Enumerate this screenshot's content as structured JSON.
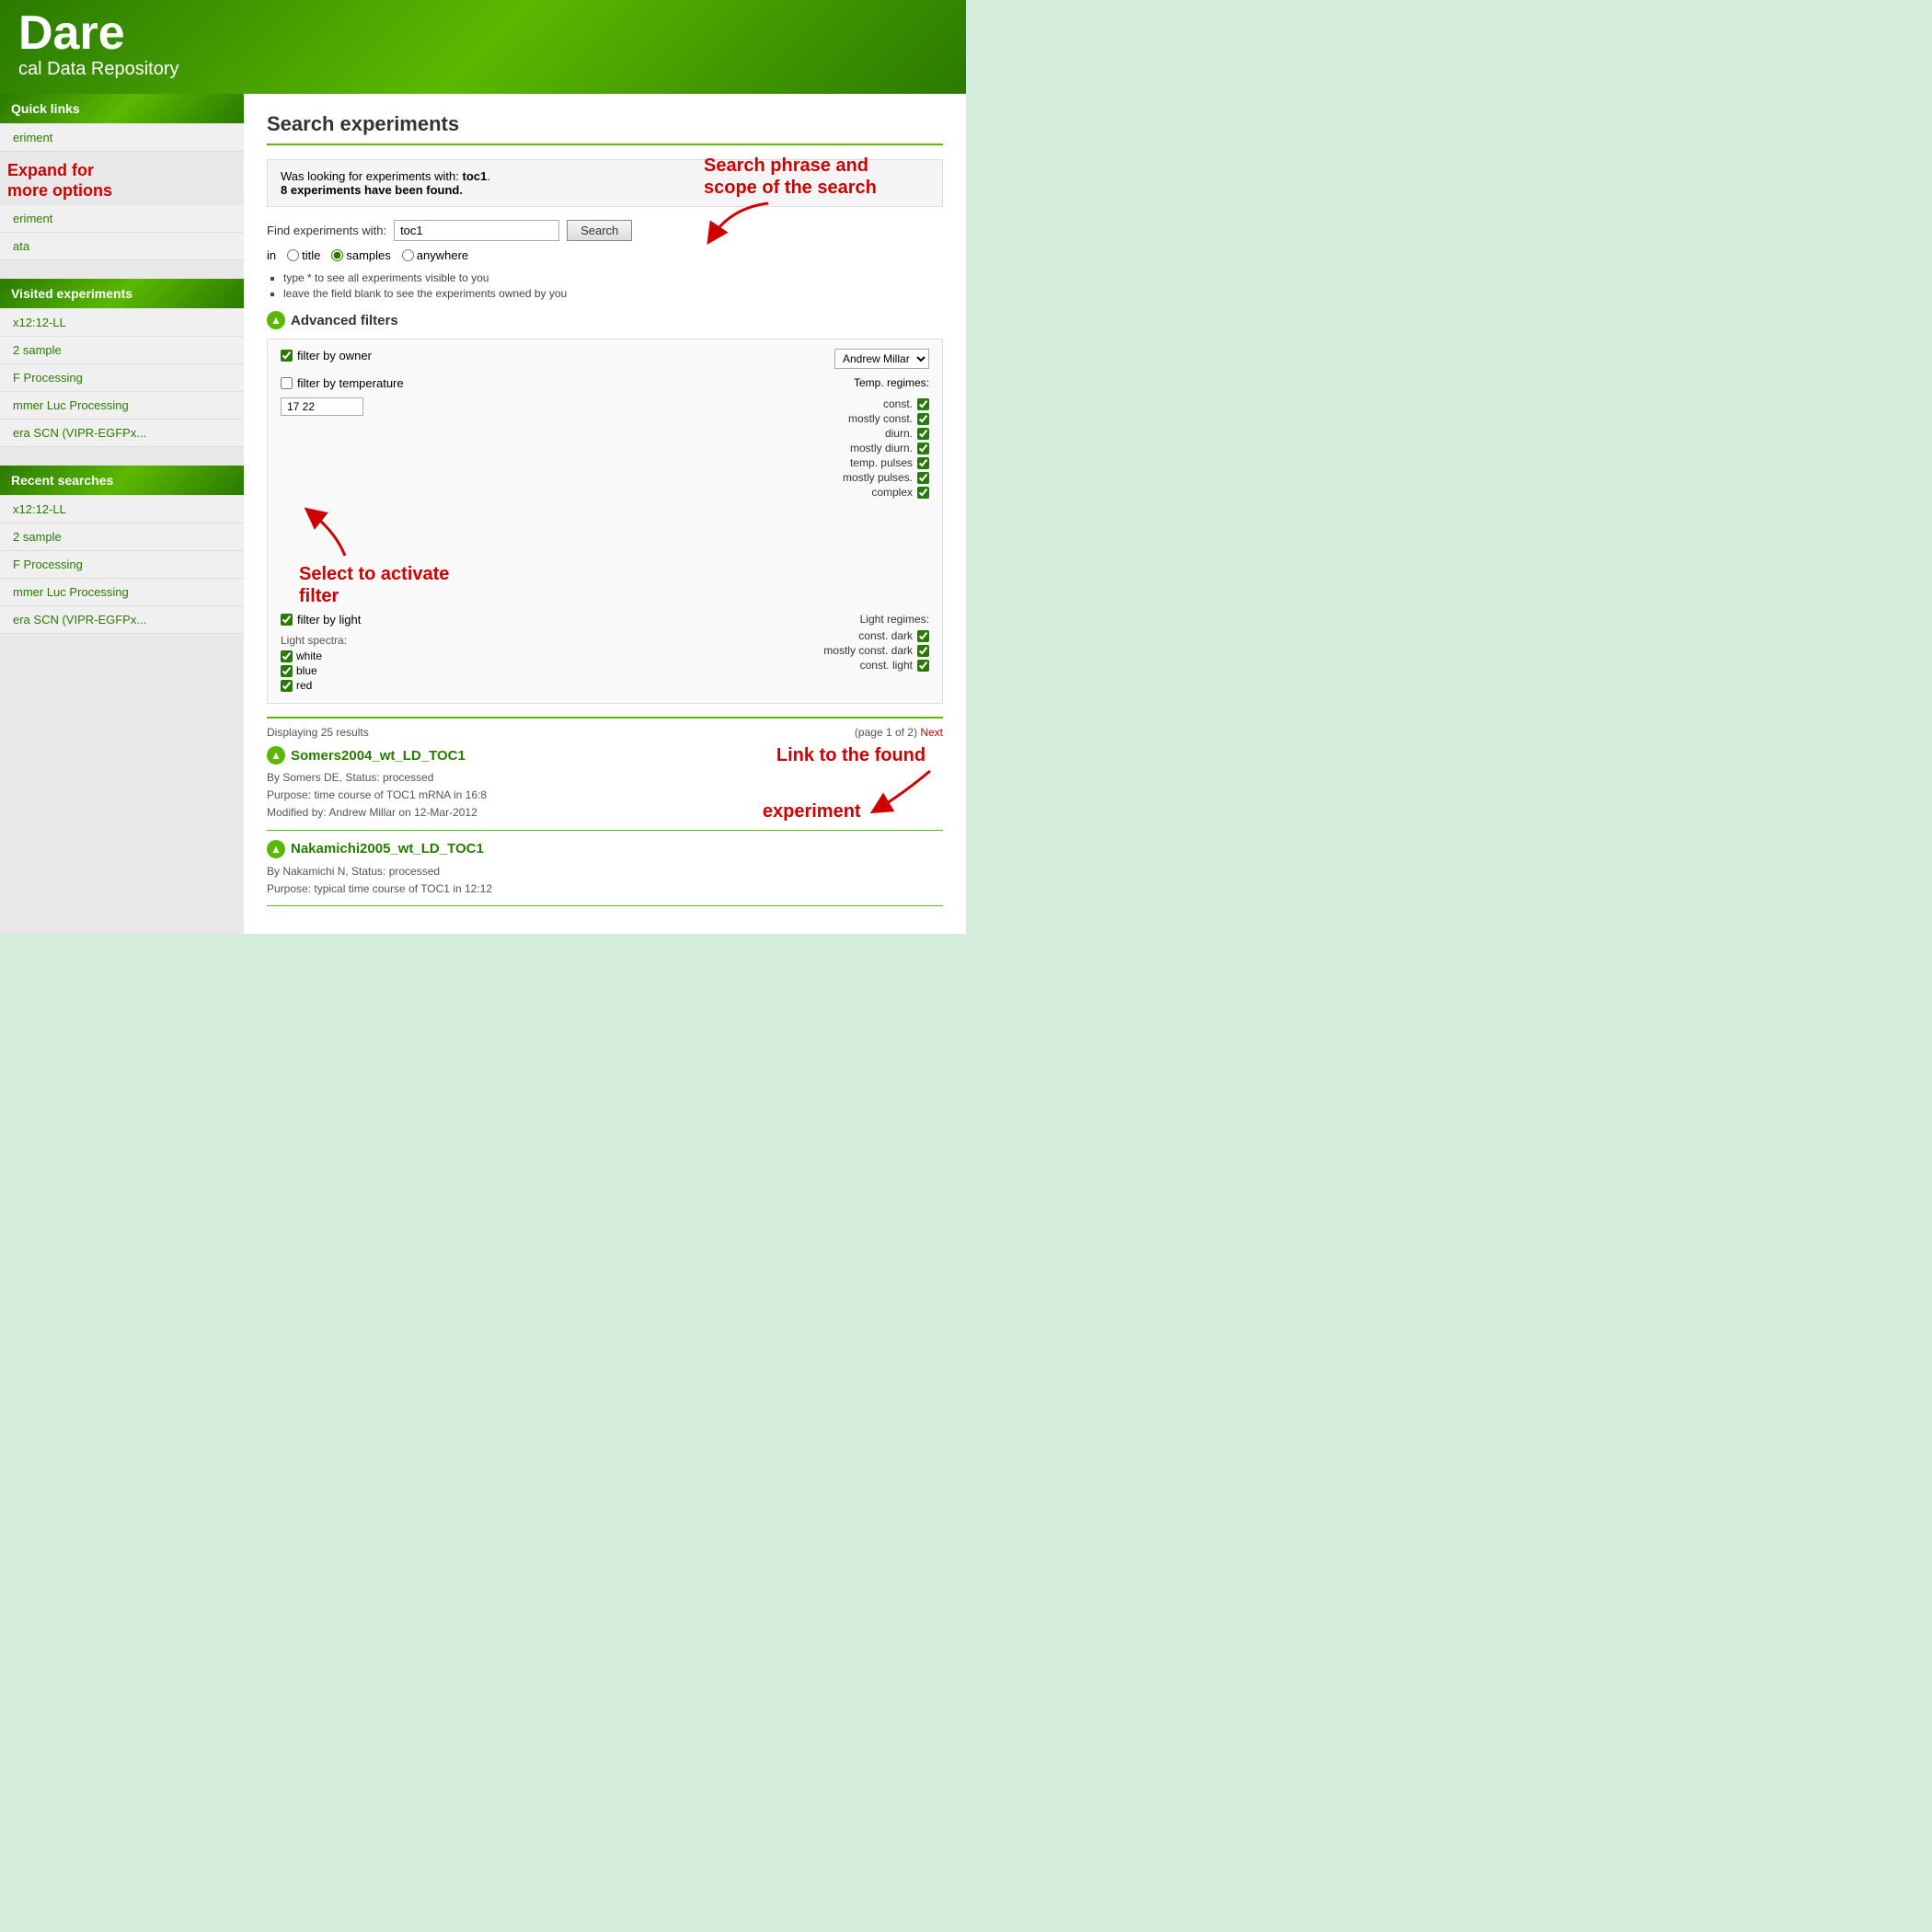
{
  "header": {
    "title": "Dare",
    "subtitle": "cal Data Repository"
  },
  "sidebar": {
    "quick_links_label": "Quick links",
    "quick_links_items": [
      {
        "label": "eriment"
      },
      {
        "label": "eriment"
      }
    ],
    "expand_annotation": "Expand for\nmore options",
    "data_label": "ata",
    "visited_label": "Visited experiments",
    "visited_items": [
      {
        "label": "x12:12-LL"
      },
      {
        "label": "2 sample"
      },
      {
        "label": "F Processing"
      },
      {
        "label": "mmer Luc Processing"
      },
      {
        "label": "era SCN (VIPR-EGFPx..."
      }
    ],
    "recent_label": "Recent searches",
    "recent_items": [
      {
        "label": "x12:12-LL"
      },
      {
        "label": "2 sample"
      },
      {
        "label": "F Processing"
      },
      {
        "label": "mmer Luc Processing"
      },
      {
        "label": "era SCN (VIPR-EGFPx..."
      }
    ]
  },
  "main": {
    "page_title": "Search experiments",
    "info_box": {
      "text": "Was looking for experiments with: toc1. 8 experiments have been found.",
      "keyword": "toc1",
      "count_text": "8 experiments have been found."
    },
    "callout_top": "Search phrase and\nscope of the search",
    "search_form": {
      "find_label": "Find experiments with:",
      "search_value": "toc1",
      "search_placeholder": "toc1",
      "search_button": "Search",
      "in_label": "in",
      "radio_title": "title",
      "radio_samples": "samples",
      "radio_anywhere": "anywhere",
      "hint1": "type * to see all experiments visible to you",
      "hint2": "leave the field blank to see the experiments owned by you"
    },
    "advanced_filters": {
      "section_label": "Advanced filters",
      "filter_owner_label": "filter by owner",
      "owner_value": "Andrew Millar",
      "filter_temp_label": "filter by temperature",
      "temp_range": "17 22",
      "temp_regimes_label": "Temp. regimes:",
      "temp_regimes": [
        {
          "label": "const.",
          "checked": true
        },
        {
          "label": "mostly const.",
          "checked": true
        },
        {
          "label": "diurn.",
          "checked": true
        },
        {
          "label": "mostly diurn.",
          "checked": true
        },
        {
          "label": "temp. pulses",
          "checked": true
        },
        {
          "label": "mostly pulses.",
          "checked": true
        },
        {
          "label": "complex",
          "checked": true
        }
      ],
      "select_annotation": "Select to activate\nfilter",
      "filter_light_label": "filter by light",
      "light_regimes_label": "Light regimes:",
      "light_regimes": [
        {
          "label": "const. dark",
          "checked": true
        },
        {
          "label": "mostly const. dark",
          "checked": true
        },
        {
          "label": "const. light",
          "checked": true
        }
      ],
      "light_spectra_label": "Light spectra:",
      "light_spectra": [
        {
          "label": "white",
          "checked": true
        },
        {
          "label": "blue",
          "checked": true
        },
        {
          "label": "red",
          "checked": true
        }
      ]
    },
    "results": {
      "displaying_text": "Displaying 25 results",
      "pagination_text": "(page 1 of 2)",
      "next_label": "Next",
      "callout_link": "Link to the found\nexperiment",
      "items": [
        {
          "title": "Somers2004_wt_LD_TOC1",
          "meta_line1": "By Somers DE, Status: processed",
          "meta_line2": "Purpose: time course of TOC1 mRNA in 16:8",
          "meta_line3": "Modified by: Andrew Millar on 12-Mar-2012"
        },
        {
          "title": "Nakamichi2005_wt_LD_TOC1",
          "meta_line1": "By Nakamichi N, Status: processed",
          "meta_line2": "Purpose: typical time course of TOC1 in 12:12"
        }
      ]
    }
  }
}
